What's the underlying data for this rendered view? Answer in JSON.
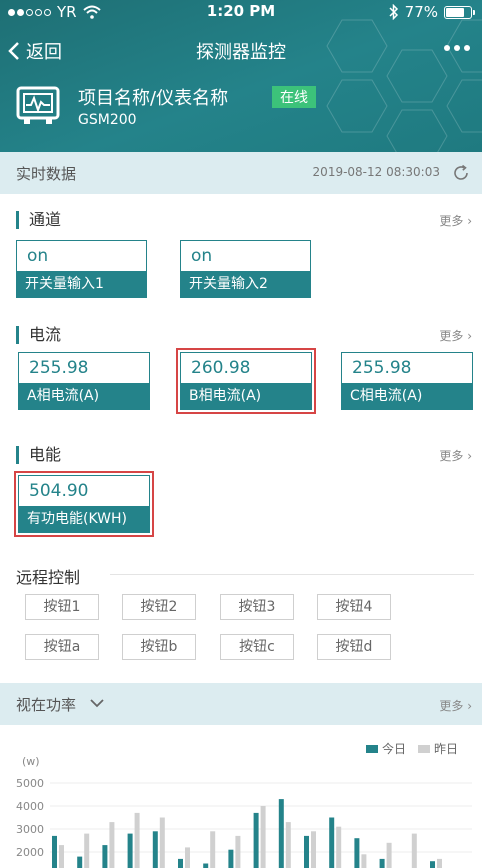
{
  "status_bar": {
    "carrier": "YR",
    "time": "1:20 PM",
    "battery": "77%"
  },
  "nav": {
    "back_label": "返回",
    "title": "探测器监控"
  },
  "device": {
    "name": "项目名称/仪表名称",
    "status": "在线",
    "model": "GSM200"
  },
  "realtime": {
    "title": "实时数据",
    "timestamp": "2019-08-12 08:30:03"
  },
  "more_label": "更多",
  "channel": {
    "title": "通道",
    "cards": [
      {
        "value": "on",
        "label": "开关量输入1"
      },
      {
        "value": "on",
        "label": "开关量输入2"
      }
    ]
  },
  "current": {
    "title": "电流",
    "cards": [
      {
        "value": "255.98",
        "label": "A相电流(A)"
      },
      {
        "value": "260.98",
        "label": "B相电流(A)"
      },
      {
        "value": "255.98",
        "label": "C相电流(A)"
      }
    ]
  },
  "energy": {
    "title": "电能",
    "cards": [
      {
        "value": "504.90",
        "label": "有功电能(KWH)"
      }
    ]
  },
  "remote": {
    "title": "远程控制",
    "buttons": [
      "按钮1",
      "按钮2",
      "按钮3",
      "按钮4",
      "按钮a",
      "按钮b",
      "按钮c",
      "按钮d"
    ]
  },
  "power": {
    "title": "视在功率"
  },
  "colors": {
    "teal": "#24838a",
    "online_green": "#3cc27a",
    "highlight_red": "#d64545",
    "yesterday_gray": "#d0d0d0"
  },
  "chart_data": {
    "type": "bar",
    "ylabel": "(w)",
    "yticks": [
      2000,
      3000,
      4000,
      5000
    ],
    "series": [
      {
        "name": "今日",
        "color": "#24838a",
        "values": [
          2700,
          1800,
          2300,
          2800,
          2900,
          1700,
          1500,
          2100,
          3700,
          4300,
          2700,
          3500,
          2600,
          1700,
          1300,
          1600
        ]
      },
      {
        "name": "昨日",
        "color": "#d0d0d0",
        "values": [
          2300,
          2800,
          3300,
          3700,
          3500,
          2200,
          2900,
          2700,
          4000,
          3300,
          2900,
          3100,
          1900,
          2400,
          2800,
          1700
        ]
      }
    ]
  }
}
